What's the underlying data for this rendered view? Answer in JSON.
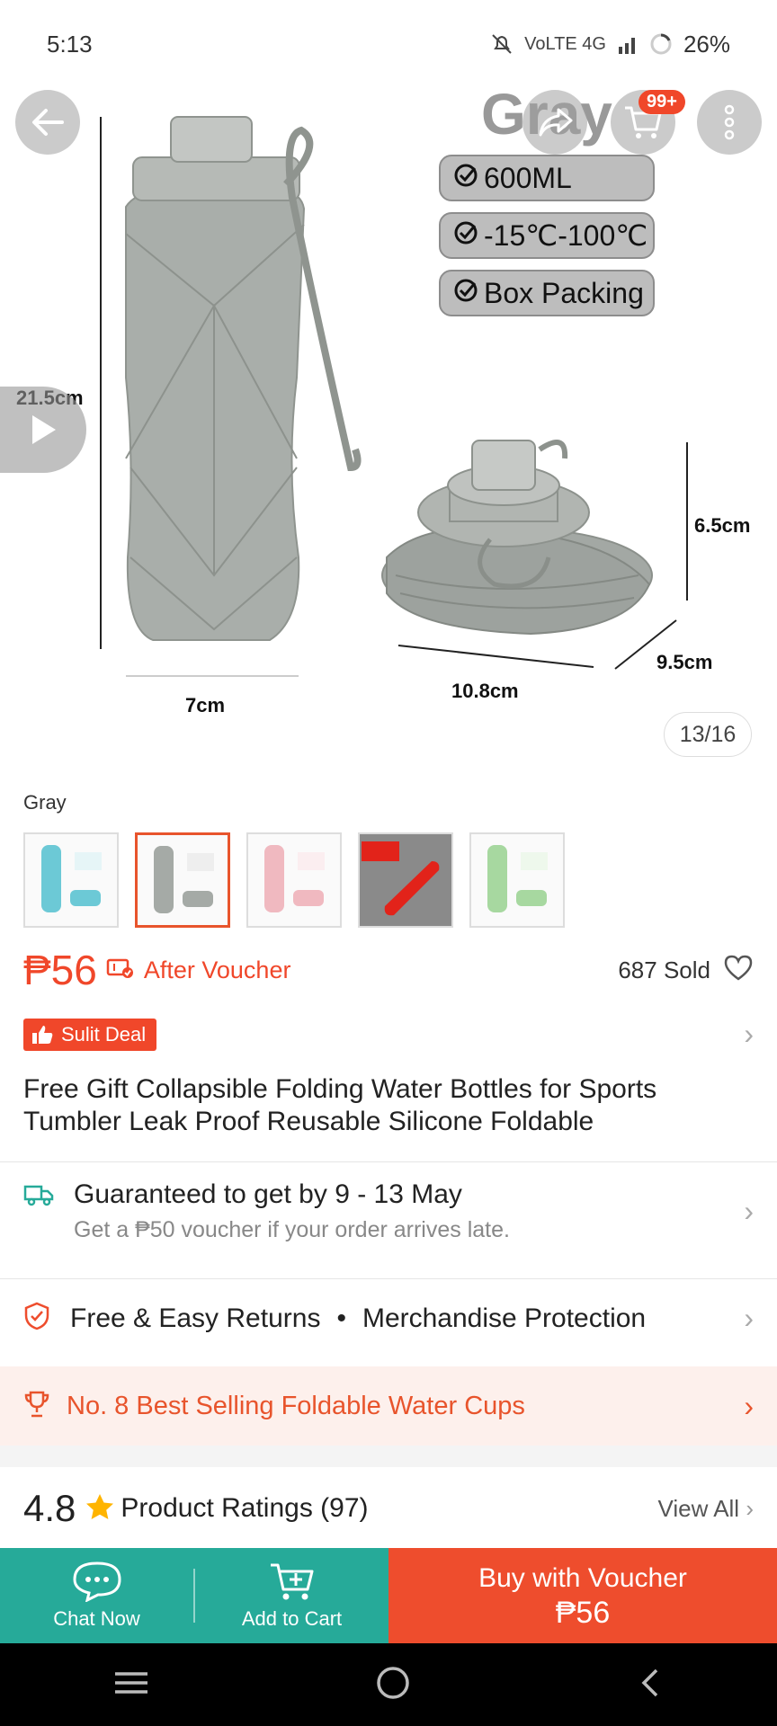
{
  "status_bar": {
    "time": "5:13",
    "indicators": "VoLTE 4G",
    "battery": "26%"
  },
  "hero": {
    "variant_word": "Gray",
    "cart_badge": "99+",
    "features": [
      "600ML",
      "-15℃-100℃",
      "Box Packing"
    ],
    "dimensions": {
      "height": "21.5cm",
      "width": "7cm",
      "folded_height": "6.5cm",
      "folded_length": "10.8cm",
      "folded_depth": "9.5cm"
    },
    "image_counter": "13/16"
  },
  "variant": {
    "selected_label": "Gray",
    "thumbnails": [
      {
        "name": "Blue",
        "color": "#6cc9d6"
      },
      {
        "name": "Gray",
        "color": "#a5aaa6"
      },
      {
        "name": "Pink",
        "color": "#f0b9c0"
      },
      {
        "name": "Red",
        "color": "#e2231a"
      },
      {
        "name": "Green",
        "color": "#a7d8a0"
      }
    ]
  },
  "price": {
    "amount": "₱56",
    "after_voucher": "After Voucher",
    "sold": "687 Sold"
  },
  "deal": {
    "label": "Sulit Deal"
  },
  "product": {
    "title": "Free Gift Collapsible Folding Water Bottles for Sports Tumbler Leak Proof Reusable Silicone Foldable"
  },
  "shipping": {
    "main": "Guaranteed to get by 9 - 13 May",
    "sub": "Get a ₱50 voucher if your order arrives late."
  },
  "returns": {
    "left": "Free & Easy Returns",
    "separator": "•",
    "right": "Merchandise Protection"
  },
  "best_selling": {
    "text": "No. 8 Best Selling Foldable Water Cups"
  },
  "ratings": {
    "score": "4.8",
    "label": "Product Ratings (97)",
    "view_all": "View All"
  },
  "actions": {
    "chat": "Chat Now",
    "add_to_cart": "Add to Cart",
    "buy_line1": "Buy with Voucher",
    "buy_line2": "₱56"
  },
  "colors": {
    "brand_orange": "#ee4d2d",
    "teal": "#26aa99"
  }
}
